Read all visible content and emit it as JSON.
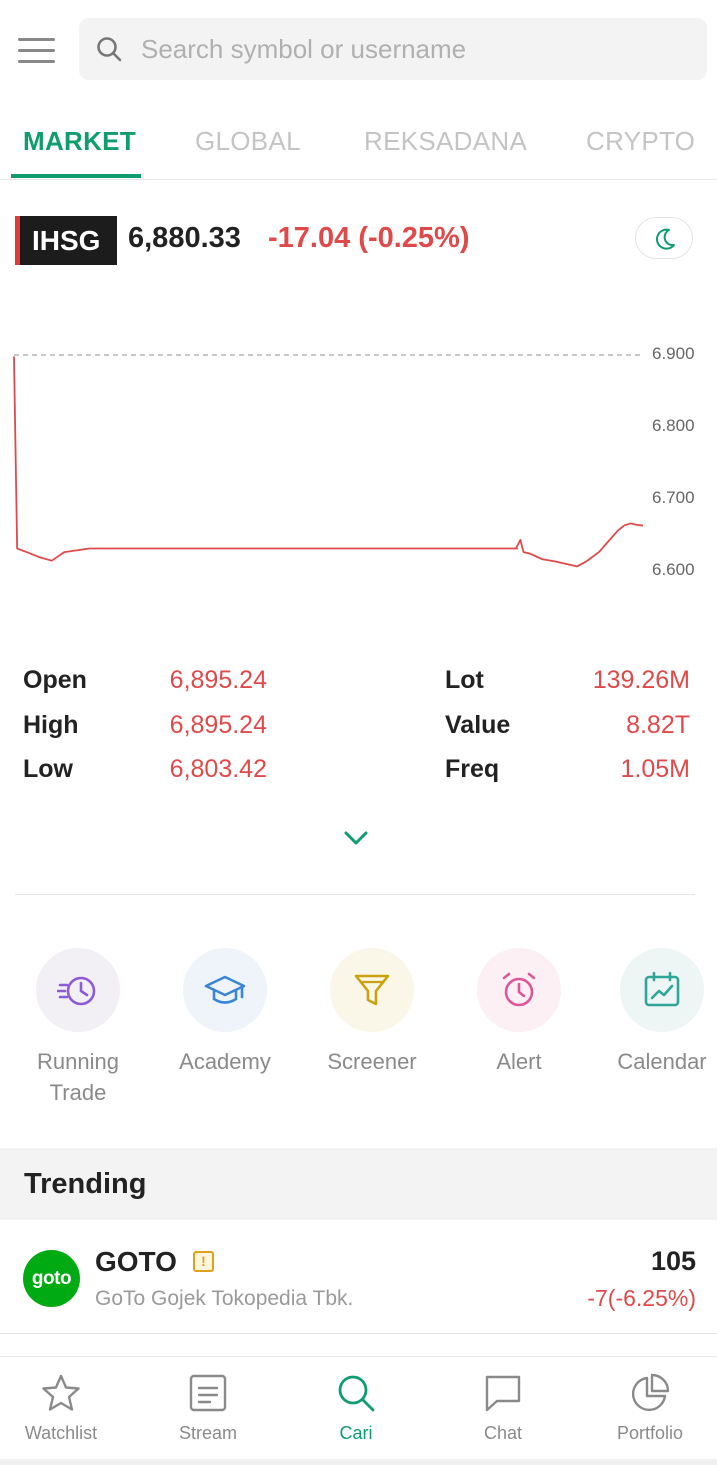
{
  "search": {
    "placeholder": "Search symbol or username"
  },
  "tabs": [
    {
      "label": "MARKET",
      "active": true
    },
    {
      "label": "GLOBAL",
      "active": false
    },
    {
      "label": "REKSADANA",
      "active": false
    },
    {
      "label": "CRYPTO",
      "active": false
    }
  ],
  "index": {
    "symbol": "IHSG",
    "price": "6,880.33",
    "change": "-17.04 (-0.25%)",
    "theme_icon": "moon-icon"
  },
  "chart_data": {
    "type": "line",
    "title": "",
    "xlabel": "",
    "ylabel": "",
    "ylim": [
      6600,
      6900
    ],
    "yticks": [
      "6.900",
      "6.800",
      "6.700",
      "6.600"
    ],
    "reference_line": 6900,
    "series": [
      {
        "color": "#e0494a",
        "x": [
          0,
          0.5,
          2,
          4,
          6,
          8,
          12,
          20,
          40,
          60,
          80,
          79.8,
          80.5,
          81,
          82,
          84,
          86,
          88,
          89.5,
          91,
          93,
          95,
          96,
          97,
          98,
          99,
          100
        ],
        "y": [
          6898,
          6630,
          6625,
          6618,
          6613,
          6625,
          6630,
          6630,
          6630,
          6630,
          6630,
          6630,
          6642,
          6625,
          6623,
          6615,
          6612,
          6608,
          6605,
          6612,
          6625,
          6645,
          6655,
          6662,
          6665,
          6663,
          6662
        ]
      }
    ]
  },
  "stats": {
    "left": [
      {
        "label": "Open",
        "value": "6,895.24"
      },
      {
        "label": "High",
        "value": "6,895.24"
      },
      {
        "label": "Low",
        "value": "6,803.42"
      }
    ],
    "right": [
      {
        "label": "Lot",
        "value": "139.26M"
      },
      {
        "label": "Value",
        "value": "8.82T"
      },
      {
        "label": "Freq",
        "value": "1.05M"
      }
    ]
  },
  "quick_menu": [
    {
      "label": "Running Trade",
      "icon": "running-trade-icon",
      "color": "#8e5bd6",
      "bg": "#f2f0f5"
    },
    {
      "label": "Academy",
      "icon": "graduation-cap-icon",
      "color": "#3a86d6",
      "bg": "#eef4fa"
    },
    {
      "label": "Screener",
      "icon": "funnel-icon",
      "color": "#c9a20e",
      "bg": "#fbf7e8"
    },
    {
      "label": "Alert",
      "icon": "alarm-clock-icon",
      "color": "#e0559a",
      "bg": "#fcf0f4"
    },
    {
      "label": "Calendar",
      "icon": "calendar-chart-icon",
      "color": "#2fa59a",
      "bg": "#edf6f5"
    }
  ],
  "trending": {
    "title": "Trending",
    "items": [
      {
        "logo_text": "goto",
        "symbol": "GOTO",
        "name": "GoTo Gojek Tokopedia Tbk.",
        "price": "105",
        "change": "-7(-6.25%)",
        "flag": "!"
      }
    ]
  },
  "bottom_nav": [
    {
      "label": "Watchlist",
      "icon": "star-icon",
      "active": false
    },
    {
      "label": "Stream",
      "icon": "stream-icon",
      "active": false
    },
    {
      "label": "Cari",
      "icon": "search-icon",
      "active": true
    },
    {
      "label": "Chat",
      "icon": "chat-bubble-icon",
      "active": false
    },
    {
      "label": "Portfolio",
      "icon": "pie-chart-icon",
      "active": false
    }
  ],
  "colors": {
    "accent": "#0f9d6b",
    "negative": "#e0494a",
    "muted": "#8a8a8a"
  }
}
